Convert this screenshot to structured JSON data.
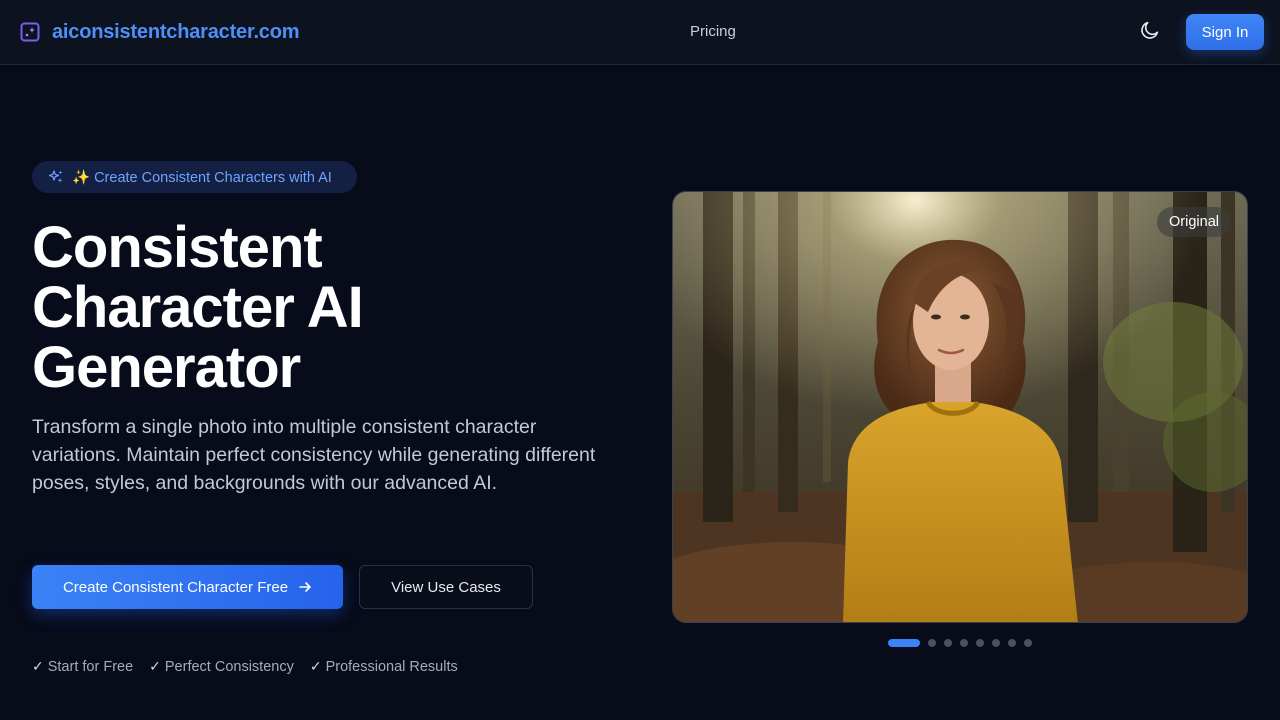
{
  "header": {
    "logo_text": "aiconsistentcharacter.com",
    "nav_pricing": "Pricing",
    "signin_label": "Sign In"
  },
  "hero": {
    "badge_text": "✨ Create Consistent Characters with AI",
    "title_lines": [
      "Consistent",
      "Character AI",
      "Generator"
    ],
    "description": "Transform a single photo into multiple consistent character variations. Maintain perfect consistency while generating different poses, styles, and backgrounds with our advanced AI.",
    "primary_cta": "Create Consistent Character Free",
    "secondary_cta": "View Use Cases",
    "features": [
      "Start for Free",
      "Perfect Consistency",
      "Professional Results"
    ],
    "check_mark": "✓"
  },
  "carousel": {
    "image_label": "Original",
    "slide_count": 8,
    "active_index": 0
  },
  "colors": {
    "accent": "#3b82f6",
    "background": "#070b1a",
    "header_bg": "#0d121f",
    "badge_text": "#6ea3ff"
  },
  "icons": {
    "logo": "sparkle-square-icon",
    "theme": "moon-icon",
    "badge": "sparkles-icon",
    "cta": "arrow-right-icon"
  }
}
